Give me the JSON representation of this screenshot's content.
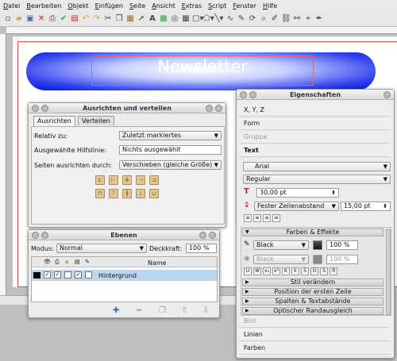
{
  "menu": [
    {
      "label": "Datei",
      "u": "D",
      "rest": "atei"
    },
    {
      "label": "Bearbeiten",
      "u": "B",
      "rest": "earbeiten"
    },
    {
      "label": "Objekt",
      "u": "O",
      "rest": "bjekt"
    },
    {
      "label": "Einfügen",
      "u": "E",
      "rest": "infügen"
    },
    {
      "label": "Seite",
      "u": "S",
      "rest": "eite"
    },
    {
      "label": "Ansicht",
      "u": "A",
      "rest": "nsicht"
    },
    {
      "label": "Extras",
      "u": "E",
      "rest": "xtras"
    },
    {
      "label": "Script",
      "u": "S",
      "rest": "cript"
    },
    {
      "label": "Fenster",
      "u": "F",
      "rest": "enster"
    },
    {
      "label": "Hilfe",
      "u": "H",
      "rest": "ilfe"
    }
  ],
  "document": {
    "banner_text": "Newsletter"
  },
  "align_dialog": {
    "title": "Ausrichten und verteilen",
    "tabs": [
      "Ausrichten",
      "Verteilen"
    ],
    "relative_label": "Relativ zu:",
    "relative_value": "Zuletzt markiertes",
    "guide_label": "Ausgewählte Hilfslinie:",
    "guide_value": "Nichts ausgewählt",
    "edges_label": "Seiten ausrichten durch:",
    "edges_value": "Verschieben (gleiche Größe)"
  },
  "layers_dialog": {
    "title": "Ebenen",
    "mode_label": "Modus:",
    "mode_value": "Normal",
    "opacity_label": "Deckkraft:",
    "opacity_value": "100 %",
    "name_header": "Name",
    "layer_name": "Hintergrund"
  },
  "properties": {
    "title": "Eigenschaften",
    "rows": [
      "X, Y, Z",
      "Form",
      "Gruppe",
      "Text"
    ],
    "font": "Arial",
    "style": "Regular",
    "size": "30,00 pt",
    "line_spacing_mode": "Fester Zeilenabstand",
    "line_spacing": "15,00 pt",
    "colors_header": "Farben & Effekte",
    "stroke_color": "Black",
    "stroke_shade": "100 %",
    "fill_color": "Black",
    "fill_shade": "100 %",
    "sections": [
      "Stil verändern",
      "Position der ersten Zeile",
      "Spalten & Textabstände",
      "Optischer Randausgleich"
    ],
    "bottom_rows": [
      "Bild",
      "Linien",
      "Farben"
    ]
  }
}
